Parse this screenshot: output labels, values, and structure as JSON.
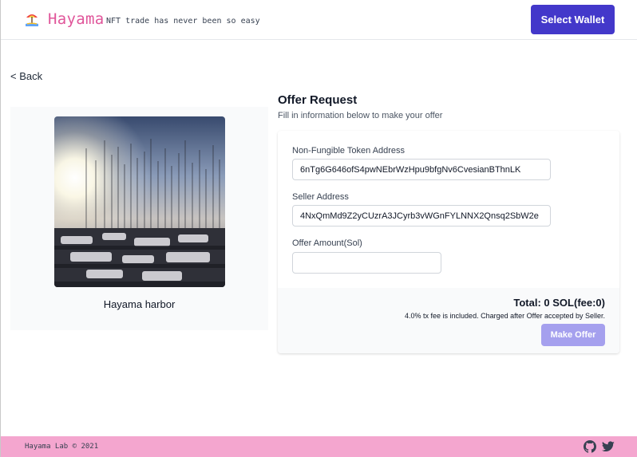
{
  "header": {
    "brand": "Hayama",
    "tagline": "NFT trade has never been so easy",
    "select_wallet_label": "Select Wallet",
    "logo_icon": "beach-umbrella-icon"
  },
  "nav": {
    "back_label": "< Back"
  },
  "nft": {
    "name": "Hayama harbor",
    "image": "harbor-sunset-photo"
  },
  "offer": {
    "title": "Offer Request",
    "subtitle": "Fill in information below to make your offer",
    "fields": {
      "token_address": {
        "label": "Non-Fungible Token Address",
        "value": "6nTg6G646ofS4pwNEbrWzHpu9bfgNv6CvesianBThnLK"
      },
      "seller_address": {
        "label": "Seller Address",
        "value": "4NxQmMd9Z2yCUzrA3JCyrb3vWGnFYLNNX2Qnsq2SbW2e"
      },
      "offer_amount": {
        "label": "Offer Amount(Sol)",
        "value": "",
        "placeholder": ""
      }
    },
    "total": "Total: 0 SOL(fee:0)",
    "fee_note": "4.0% tx fee is included. Charged after Offer accepted by Seller.",
    "submit_label": "Make Offer"
  },
  "footer": {
    "text": "Hayama Lab © 2021",
    "icons": [
      "github-icon",
      "twitter-icon"
    ]
  },
  "colors": {
    "brand": "#e0559a",
    "primary_button": "#4338ca",
    "disabled_button": "#a5a0ee",
    "footer_bg": "#f4a6cf"
  }
}
